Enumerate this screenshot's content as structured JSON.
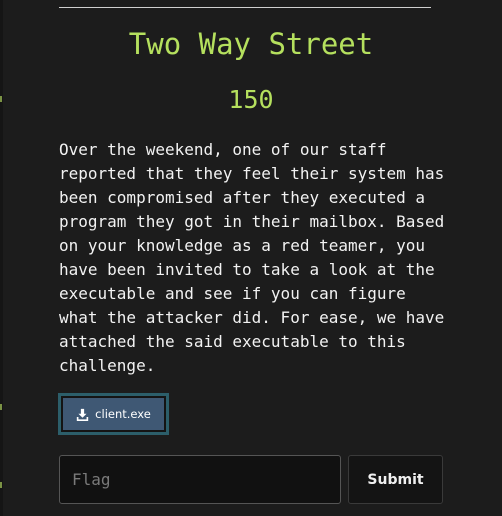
{
  "challenge": {
    "title": "Two Way Street",
    "points": "150",
    "description": "Over the weekend, one of our staff\nreported that they feel their system has\nbeen compromised after they executed a\nprogram they got in their mailbox. Based\non your knowledge as a red teamer, you\nhave been invited to take a look at the\nexecutable and see if you can figure\nwhat the attacker did. For ease, we have\nattached the said executable to this\nchallenge.",
    "attachment": {
      "label": "client.exe",
      "icon": "download-icon"
    }
  },
  "form": {
    "flag_value": "",
    "flag_placeholder": "Flag",
    "submit_label": "Submit"
  },
  "colors": {
    "accent": "#b5e05e",
    "background": "#1c1c1c",
    "file_button": "#3f5874",
    "file_button_border": "#2c5e6a",
    "text": "#f2f2f2"
  }
}
